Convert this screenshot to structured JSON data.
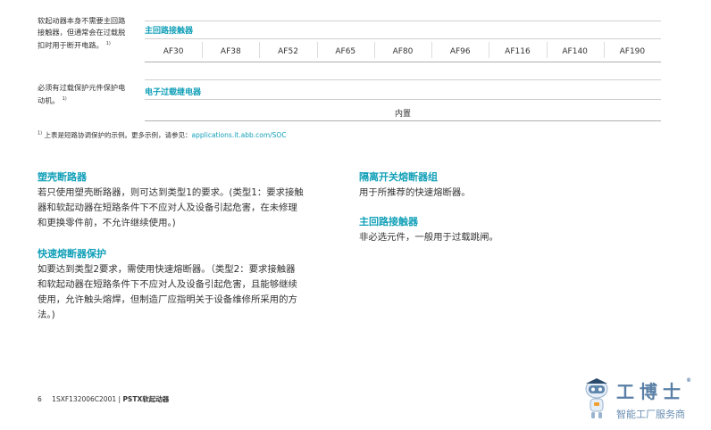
{
  "table": {
    "row1": {
      "note": [
        "软起动器本身不需要主回路",
        "接触器，但通常会在过载脱",
        "扣时用于断开电路。"
      ],
      "note_sup": "1)",
      "header": "主回路接触器",
      "cells": [
        "AF30",
        "AF38",
        "AF52",
        "AF65",
        "AF80",
        "AF96",
        "AF116",
        "AF140",
        "AF190"
      ]
    },
    "row2": {
      "note": [
        "必须有过载保护元件保护电",
        "动机。"
      ],
      "note_sup": "1)",
      "header": "电子过载继电器",
      "value": "内置"
    }
  },
  "footnote": {
    "sup": "1)",
    "text": " 上表是短路协调保护的示例。更多示例，请参见：",
    "link": "applications.it.abb.com/SOC"
  },
  "sections": {
    "left": [
      {
        "title": "塑壳断路器",
        "lines": [
          "若只使用塑壳断路器，则可达到类型1的要求。(类型1：要求接触",
          "器和软起动器在短路条件下不应对人及设备引起危害，在未修理",
          "和更换零件前，不允许继续使用。)"
        ]
      },
      {
        "title": "快速熔断器保护",
        "lines": [
          "如要达到类型2要求，需使用快速熔断器。（类型2：要求接触器",
          "和软起动器在短路条件下不应对人及设备引起危害，且能够继续",
          "使用，允许触头熔焊，但制造厂应指明关于设备维修所采用的方",
          "法。)"
        ]
      }
    ],
    "right": [
      {
        "title": "隔离开关熔断器组",
        "lines": [
          "用于所推荐的快速熔断器。"
        ]
      },
      {
        "title": "主回路接触器",
        "lines": [
          "非必选元件，一般用于过载跳闸。"
        ]
      }
    ]
  },
  "page_footer": {
    "page": "6",
    "doc": "1SXF132006C2001",
    "sep": "|",
    "product": "PSTX软起动器"
  },
  "watermark": {
    "brand": "工博士",
    "tagline": "智能工厂服务商",
    "reg": "®"
  },
  "colors": {
    "accent": "#12a0b8",
    "text": "#333333",
    "rule": "#cfcfcf"
  }
}
